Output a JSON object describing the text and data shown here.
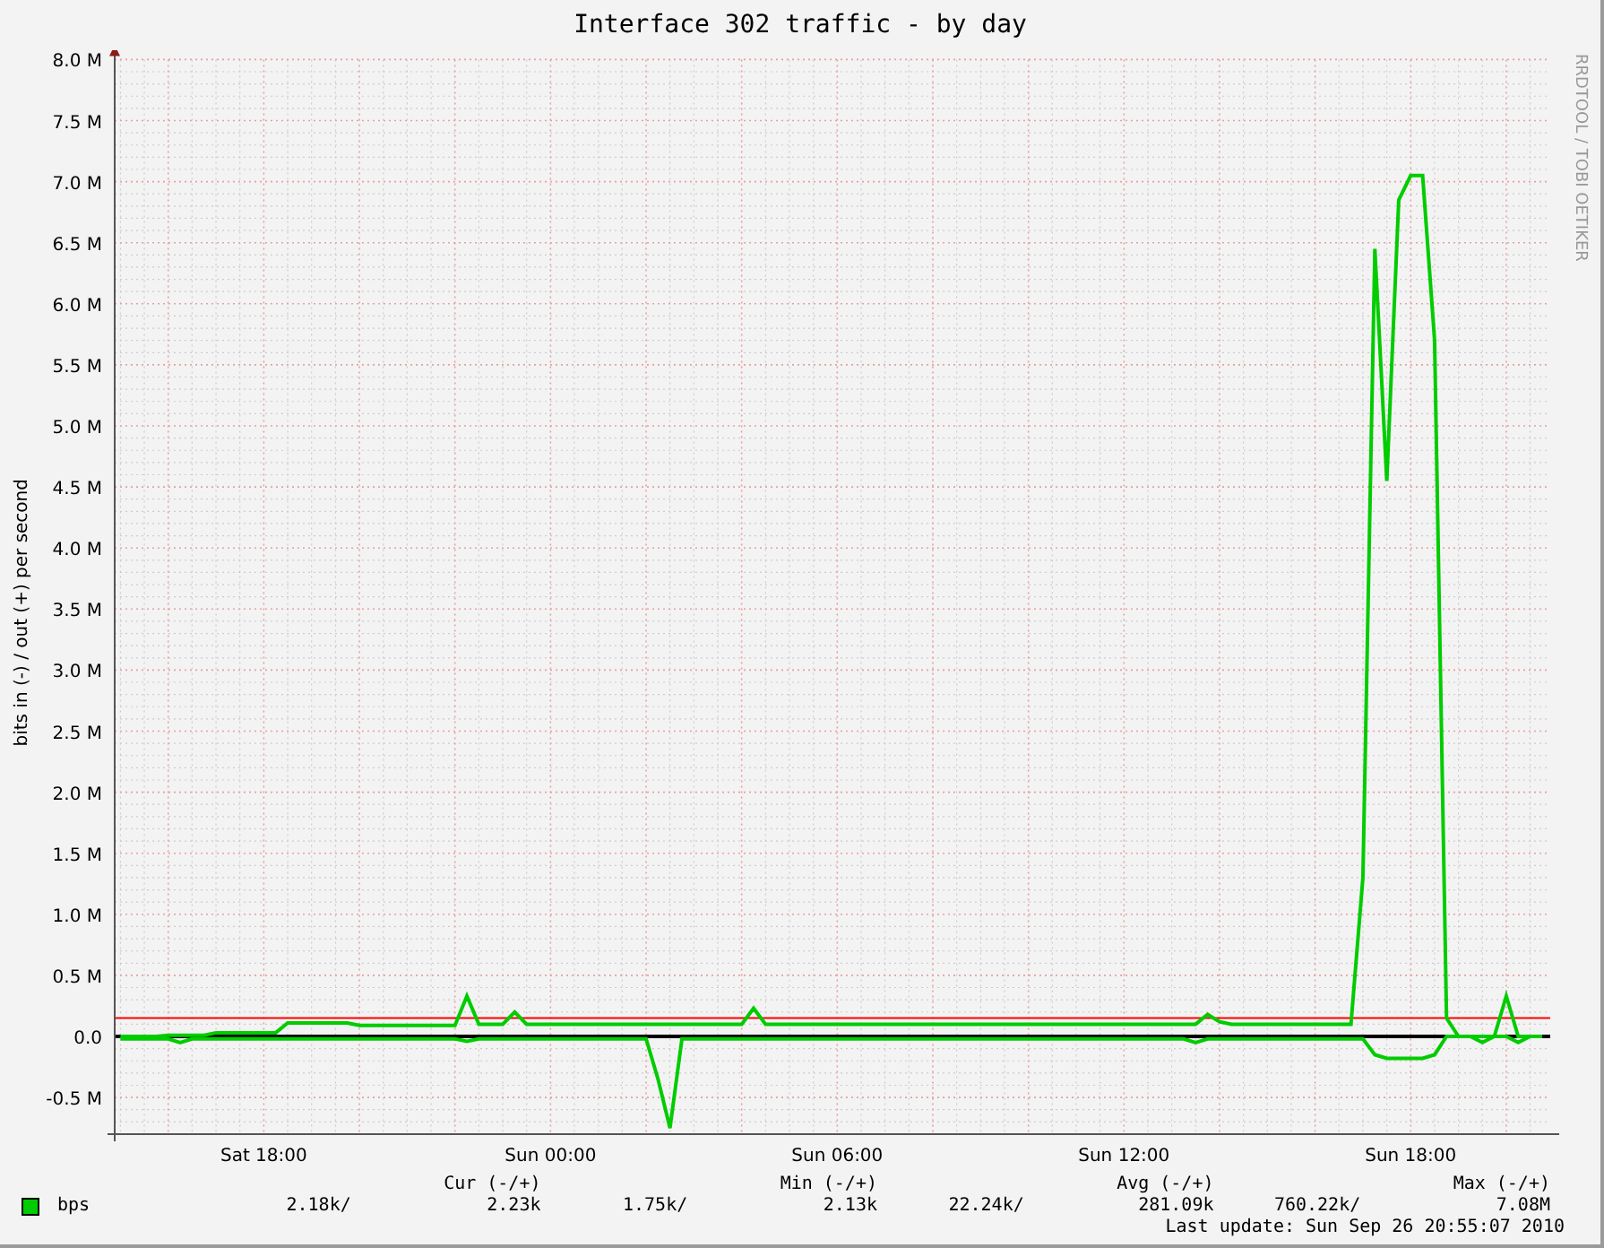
{
  "title": "Interface 302 traffic - by day",
  "side_label": "RRDTOOL / TOBI OETIKER",
  "chart_data": {
    "type": "line",
    "ylabel": "bits in (-) / out (+) per second",
    "ylim": [
      -0.8,
      8.0
    ],
    "categories": [
      null,
      null,
      null,
      null,
      null,
      null,
      null,
      null,
      null,
      null,
      null,
      null,
      "Sat 18:00",
      null,
      null,
      null,
      null,
      null,
      null,
      null,
      null,
      null,
      null,
      null,
      null,
      null,
      null,
      null,
      null,
      null,
      null,
      null,
      null,
      null,
      null,
      null,
      "Sun 00:00",
      null,
      null,
      null,
      null,
      null,
      null,
      null,
      null,
      null,
      null,
      null,
      null,
      null,
      null,
      null,
      null,
      null,
      null,
      null,
      null,
      null,
      null,
      null,
      "Sun 06:00",
      null,
      null,
      null,
      null,
      null,
      null,
      null,
      null,
      null,
      null,
      null,
      null,
      null,
      null,
      null,
      null,
      null,
      null,
      null,
      null,
      null,
      null,
      null,
      "Sun 12:00",
      null,
      null,
      null,
      null,
      null,
      null,
      null,
      null,
      null,
      null,
      null,
      null,
      null,
      null,
      null,
      null,
      null,
      null,
      null,
      null,
      null,
      null,
      null,
      "Sun 18:00",
      null,
      null,
      null,
      null,
      null,
      null,
      null,
      null,
      null,
      null,
      null
    ],
    "yticks": [
      {
        "value": -0.5,
        "label": "-0.5 M"
      },
      {
        "value": 0,
        "label": "0.0"
      },
      {
        "value": 0.5,
        "label": "0.5 M"
      },
      {
        "value": 1,
        "label": "1.0 M"
      },
      {
        "value": 1.5,
        "label": "1.5 M"
      },
      {
        "value": 2,
        "label": "2.0 M"
      },
      {
        "value": 2.5,
        "label": "2.5 M"
      },
      {
        "value": 3,
        "label": "3.0 M"
      },
      {
        "value": 3.5,
        "label": "3.5 M"
      },
      {
        "value": 4,
        "label": "4.0 M"
      },
      {
        "value": 4.5,
        "label": "4.5 M"
      },
      {
        "value": 5,
        "label": "5.0 M"
      },
      {
        "value": 5.5,
        "label": "5.5 M"
      },
      {
        "value": 6,
        "label": "6.0 M"
      },
      {
        "value": 6.5,
        "label": "6.5 M"
      },
      {
        "value": 7,
        "label": "7.0 M"
      },
      {
        "value": 7.5,
        "label": "7.5 M"
      },
      {
        "value": 8,
        "label": "8.0 M"
      }
    ],
    "series": [
      {
        "name": "bps",
        "color": "#00cc00",
        "values": [
          0,
          0,
          0,
          0,
          0.01,
          0.01,
          0.01,
          0.01,
          0.03,
          0.03,
          0.03,
          0.03,
          0.03,
          0.03,
          0.11,
          0.11,
          0.11,
          0.11,
          0.11,
          0.11,
          0.09,
          0.09,
          0.09,
          0.09,
          0.09,
          0.09,
          0.09,
          0.09,
          0.09,
          0.33,
          0.1,
          0.1,
          0.1,
          0.2,
          0.1,
          0.1,
          0.1,
          0.1,
          0.1,
          0.1,
          0.1,
          0.1,
          0.1,
          0.1,
          0.1,
          0.1,
          0.1,
          0.1,
          0.1,
          0.1,
          0.1,
          0.1,
          0.1,
          0.23,
          0.1,
          0.1,
          0.1,
          0.1,
          0.1,
          0.1,
          0.1,
          0.1,
          0.1,
          0.1,
          0.1,
          0.1,
          0.1,
          0.1,
          0.1,
          0.1,
          0.1,
          0.1,
          0.1,
          0.1,
          0.1,
          0.1,
          0.1,
          0.1,
          0.1,
          0.1,
          0.1,
          0.1,
          0.1,
          0.1,
          0.1,
          0.1,
          0.1,
          0.1,
          0.1,
          0.1,
          0.1,
          0.18,
          0.12,
          0.1,
          0.1,
          0.1,
          0.1,
          0.1,
          0.1,
          0.1,
          0.1,
          0.1,
          0.1,
          0.1,
          1.3,
          6.45,
          4.55,
          6.85,
          7.05,
          7.05,
          5.7,
          0.15,
          0,
          0,
          0,
          0,
          0.33,
          0,
          0,
          0
        ]
      },
      {
        "color": "#00cc00",
        "values": [
          -0.02,
          -0.02,
          -0.02,
          -0.02,
          -0.02,
          -0.05,
          -0.02,
          -0.02,
          -0.02,
          -0.02,
          -0.02,
          -0.02,
          -0.02,
          -0.02,
          -0.02,
          -0.02,
          -0.02,
          -0.02,
          -0.02,
          -0.02,
          -0.02,
          -0.02,
          -0.02,
          -0.02,
          -0.02,
          -0.02,
          -0.02,
          -0.02,
          -0.02,
          -0.04,
          -0.02,
          -0.02,
          -0.02,
          -0.02,
          -0.02,
          -0.02,
          -0.02,
          -0.02,
          -0.02,
          -0.02,
          -0.02,
          -0.02,
          -0.02,
          -0.02,
          -0.02,
          -0.35,
          -0.75,
          -0.02,
          -0.02,
          -0.02,
          -0.02,
          -0.02,
          -0.02,
          -0.02,
          -0.02,
          -0.02,
          -0.02,
          -0.02,
          -0.02,
          -0.02,
          -0.02,
          -0.02,
          -0.02,
          -0.02,
          -0.02,
          -0.02,
          -0.02,
          -0.02,
          -0.02,
          -0.02,
          -0.02,
          -0.02,
          -0.02,
          -0.02,
          -0.02,
          -0.02,
          -0.02,
          -0.02,
          -0.02,
          -0.02,
          -0.02,
          -0.02,
          -0.02,
          -0.02,
          -0.02,
          -0.02,
          -0.02,
          -0.02,
          -0.02,
          -0.02,
          -0.05,
          -0.02,
          -0.02,
          -0.02,
          -0.02,
          -0.02,
          -0.02,
          -0.02,
          -0.02,
          -0.02,
          -0.02,
          -0.02,
          -0.02,
          -0.02,
          -0.02,
          -0.15,
          -0.18,
          -0.18,
          -0.18,
          -0.18,
          -0.15,
          0,
          0,
          0,
          -0.05,
          0,
          0,
          -0.05,
          0,
          0
        ]
      }
    ],
    "grid": true,
    "ref_lines": [
      {
        "axis": "y",
        "value": 0.15,
        "color": "#ff0000"
      }
    ]
  },
  "legend": {
    "headers": [
      "Cur (-/+)",
      "Min (-/+)",
      "Avg (-/+)",
      "Max (-/+)"
    ],
    "rows": [
      {
        "values": [
          "2.18k/",
          "2.23k",
          "1.75k/",
          "2.13k",
          "22.24k/",
          "281.09k",
          "760.22k/",
          "7.08M"
        ]
      }
    ]
  },
  "last_update": "Last update: Sun Sep 26 20:55:07 2010"
}
